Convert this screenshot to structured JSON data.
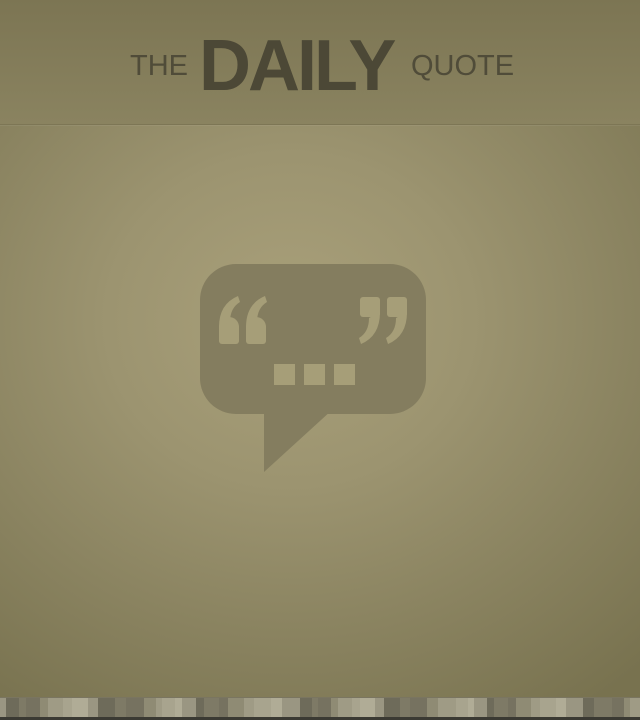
{
  "header": {
    "title_prefix": "THE",
    "title_main": "DAILY",
    "title_suffix": "QUOTE"
  },
  "content": {
    "placeholder_icon": "quote-speech-bubble-icon"
  },
  "colors": {
    "background": "#9c9470",
    "header_background": "#827b58",
    "logo_text": "#504c39",
    "icon_fill": "#847d5f"
  }
}
